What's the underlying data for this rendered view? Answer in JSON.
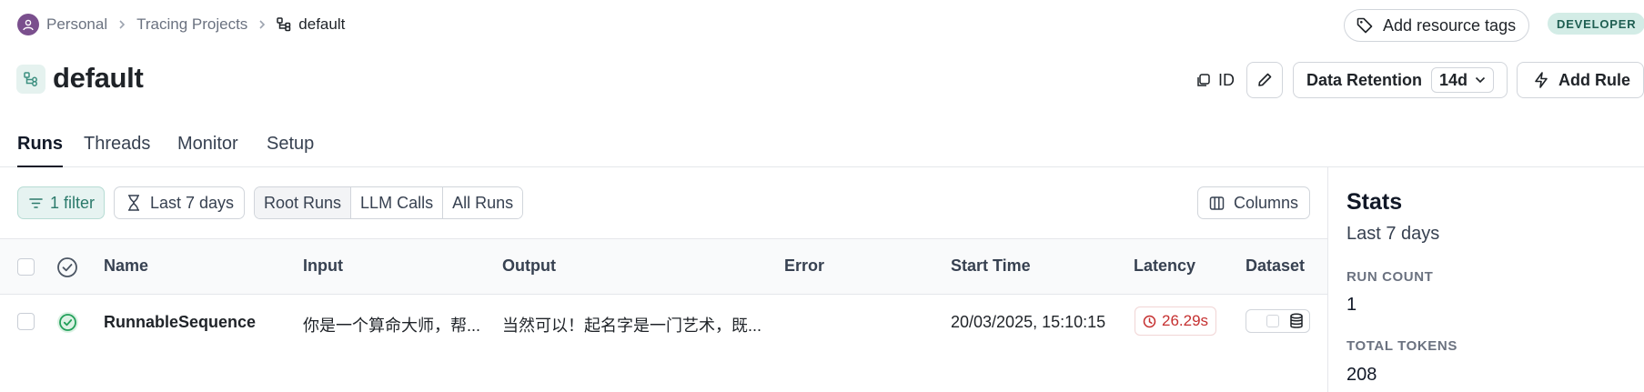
{
  "breadcrumb": {
    "workspace": "Personal",
    "section": "Tracing Projects",
    "project": "default"
  },
  "header": {
    "tags_button": "Add resource tags",
    "badge": "DEVELOPER",
    "title": "default",
    "id_label": "ID",
    "retention_label": "Data Retention",
    "retention_value": "14d",
    "add_rule": "Add Rule"
  },
  "tabs": [
    {
      "label": "Runs",
      "active": true
    },
    {
      "label": "Threads",
      "active": false
    },
    {
      "label": "Monitor",
      "active": false
    },
    {
      "label": "Setup",
      "active": false
    }
  ],
  "toolbar": {
    "filter": "1 filter",
    "date_range": "Last 7 days",
    "segments": [
      {
        "label": "Root Runs",
        "active": true
      },
      {
        "label": "LLM Calls",
        "active": false
      },
      {
        "label": "All Runs",
        "active": false
      }
    ],
    "columns": "Columns"
  },
  "table": {
    "headers": {
      "name": "Name",
      "input": "Input",
      "output": "Output",
      "error": "Error",
      "start_time": "Start Time",
      "latency": "Latency",
      "dataset": "Dataset"
    },
    "rows": [
      {
        "name": "RunnableSequence",
        "input": "你是一个算命大师，帮...",
        "output": "当然可以！起名字是一门艺术，既...",
        "error": "",
        "start_time": "20/03/2025, 15:10:15",
        "latency": "26.29s",
        "status": "success"
      }
    ]
  },
  "stats": {
    "title": "Stats",
    "period": "Last 7 days",
    "run_count_label": "RUN COUNT",
    "run_count": "1",
    "total_tokens_label": "TOTAL TOKENS",
    "total_tokens": "208"
  },
  "colors": {
    "accent": "#2b7a6b",
    "success": "#22a05a",
    "latency_red": "#c53030",
    "avatar": "#7a4f8d"
  }
}
